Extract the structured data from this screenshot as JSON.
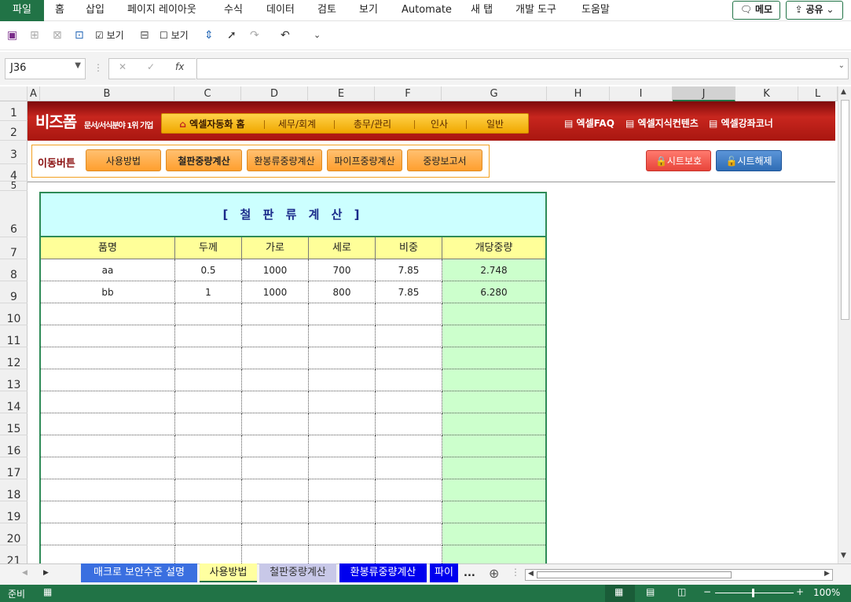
{
  "menu": {
    "file": "파일",
    "items": [
      "홈",
      "삽입",
      "페이지 레이아웃",
      "수식",
      "데이터",
      "검토",
      "보기",
      "Automate",
      "새 탭",
      "개발 도구",
      "도움말"
    ],
    "memo": "메모",
    "share": "공유"
  },
  "qat": {
    "view1": "보기",
    "view2": "보기"
  },
  "formula": {
    "namebox": "J36",
    "fx": "fx",
    "cancel": "✕",
    "confirm": "✓",
    "value": ""
  },
  "columns": [
    "A",
    "B",
    "C",
    "D",
    "E",
    "F",
    "G",
    "H",
    "I",
    "J",
    "K",
    "L"
  ],
  "rows": [
    "1",
    "2",
    "3",
    "4",
    "5",
    "6",
    "7",
    "8",
    "9",
    "10",
    "11",
    "12",
    "13",
    "14",
    "15",
    "16",
    "17",
    "18",
    "19",
    "20",
    "21"
  ],
  "banner": {
    "logo": "비즈폼",
    "tagline": "문서/서식분야 1위 기업",
    "nav": [
      "엑셀자동화 홈",
      "세무/회계",
      "총무/관리",
      "인사",
      "일반"
    ],
    "links": [
      "엑셀FAQ",
      "엑셀지식컨텐츠",
      "엑셀강좌코너"
    ]
  },
  "move": {
    "label": "이동버튼",
    "buttons": [
      "사용방법",
      "철판중량계산",
      "환봉류중량계산",
      "파이프중량계산",
      "중량보고서"
    ]
  },
  "protect": {
    "lock": "시트보호",
    "unlock": "시트해제",
    "lock_color": "#e8443a",
    "unlock_color": "#2f6db5"
  },
  "table": {
    "title": "[ 철 판 류 계 산 ]",
    "headers": [
      "품명",
      "두께",
      "가로",
      "세로",
      "비중",
      "개당중량"
    ],
    "rows": [
      [
        "aa",
        "0.5",
        "1000",
        "700",
        "7.85",
        "2.748"
      ],
      [
        "bb",
        "1",
        "1000",
        "800",
        "7.85",
        "6.280"
      ]
    ]
  },
  "sheets": [
    "매크로 보안수준 설명",
    "사용방법",
    "철판중량계산",
    "환봉류중량계산",
    "파이"
  ],
  "sheets_more": "...",
  "status": {
    "ready": "준비",
    "zoom": "100%"
  },
  "colors": {
    "excel_green": "#217346",
    "header_yellow": "#ffff99",
    "title_cyan": "#ccffff",
    "weight_green": "#ccffcc"
  }
}
